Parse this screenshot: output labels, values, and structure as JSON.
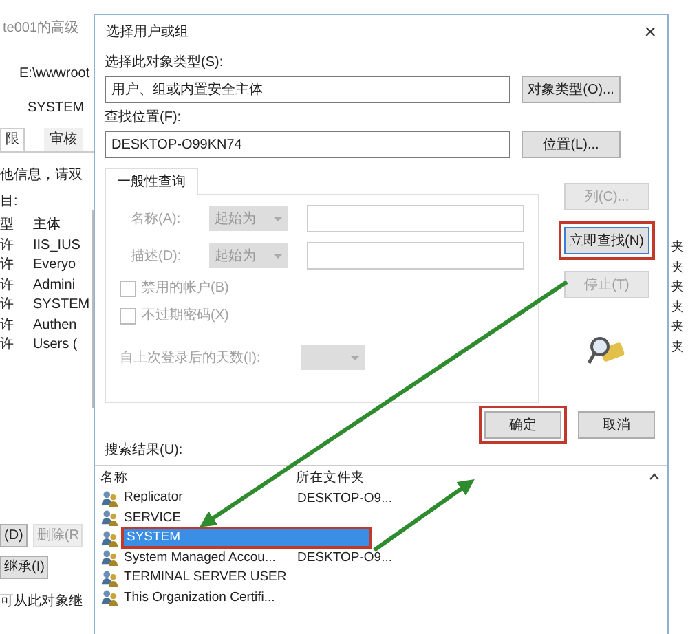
{
  "background_window": {
    "title": "te001的高级",
    "path": "E:\\wwwroot",
    "owner": "SYSTEM",
    "tabs": [
      {
        "label": "限",
        "selected": true
      },
      {
        "label": "审核",
        "selected": false
      }
    ],
    "hint": "他信息，请双",
    "entries_label": "目:",
    "columns": [
      "型",
      "主体"
    ],
    "rows": [
      [
        "许",
        "IIS_IUS"
      ],
      [
        "许",
        "Everyo"
      ],
      [
        "许",
        "Admini"
      ],
      [
        "许",
        "SYSTEM"
      ],
      [
        "许",
        "Authen"
      ],
      [
        "许",
        "Users ("
      ]
    ],
    "right_column": [
      "夹",
      "夹",
      "夹",
      "夹",
      "夹",
      "夹"
    ],
    "buttons": [
      {
        "label": "(D)",
        "disabled": false
      },
      {
        "label": "删除(R",
        "disabled": true
      }
    ],
    "inherit_button": "继承(I)",
    "inherit_note": "可从此对象继"
  },
  "dialog": {
    "title": "选择用户或组",
    "close": "×",
    "object_type": {
      "label": "选择此对象类型(S):",
      "value": "用户、组或内置安全主体",
      "button": "对象类型(O)..."
    },
    "location": {
      "label": "查找位置(F):",
      "value": "DESKTOP-O99KN74",
      "button": "位置(L)..."
    },
    "query_tab": "一般性查询",
    "query": {
      "disabled": true,
      "fields": [
        {
          "label": "名称(A):",
          "mode": "起始为"
        },
        {
          "label": "描述(D):",
          "mode": "起始为"
        }
      ],
      "checkboxes": [
        {
          "label": "禁用的帐户(B)",
          "checked": false
        },
        {
          "label": "不过期密码(X)",
          "checked": false
        }
      ],
      "days_label": "自上次登录后的天数(I):"
    },
    "side_buttons": [
      {
        "label": "列(C)...",
        "disabled": true
      },
      {
        "label": "立即查找(N)",
        "disabled": false
      },
      {
        "label": "停止(T)",
        "disabled": true
      }
    ],
    "ok": "确定",
    "cancel": "取消",
    "results_label": "搜索结果(U):",
    "results": {
      "columns": [
        "名称",
        "所在文件夹"
      ],
      "rows": [
        {
          "name": "Replicator",
          "folder": "DESKTOP-O9...",
          "selected": false
        },
        {
          "name": "SERVICE",
          "selected": false
        },
        {
          "name": "SYSTEM",
          "selected": true
        },
        {
          "name": "System Managed Accou...",
          "folder": "DESKTOP-O9...",
          "selected": false
        },
        {
          "name": "TERMINAL SERVER USER",
          "selected": false
        },
        {
          "name": "This Organization Certifi...",
          "selected": false
        }
      ]
    }
  }
}
